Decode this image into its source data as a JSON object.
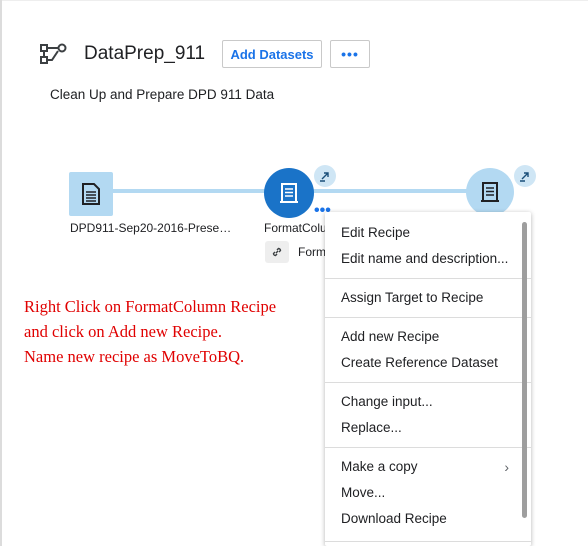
{
  "header": {
    "title": "DataPrep_911",
    "add_datasets_label": "Add Datasets",
    "more_label": "•••",
    "subtitle": "Clean Up and Prepare DPD 911 Data"
  },
  "flow": {
    "dataset_label": "DPD911-Sep20-2016-Prese…",
    "recipe_label": "FormatColumn",
    "recipe_link_label": "FormatColumn",
    "node_dots": "•••"
  },
  "annotation": {
    "line1": "Right Click on FormatColumn Recipe",
    "line2": "and click on Add new Recipe.",
    "line3": "Name new recipe as MoveToBQ."
  },
  "context_menu": {
    "edit_recipe": "Edit Recipe",
    "edit_name": "Edit name and description...",
    "assign_target": "Assign Target to Recipe",
    "add_new_recipe": "Add new Recipe",
    "create_reference": "Create Reference Dataset",
    "change_input": "Change input...",
    "replace": "Replace...",
    "make_copy": "Make a copy",
    "move": "Move...",
    "download_recipe": "Download Recipe"
  },
  "colors": {
    "accent": "#1a73e8",
    "annotation": "#e00000",
    "connector": "#b3d9f2"
  },
  "icons": {
    "flow": "flow-icon",
    "dataset": "dataset-icon",
    "recipe": "recipe-icon",
    "expand": "expand-arrow-icon",
    "link": "link-icon",
    "submenu": "chevron-right-icon"
  }
}
